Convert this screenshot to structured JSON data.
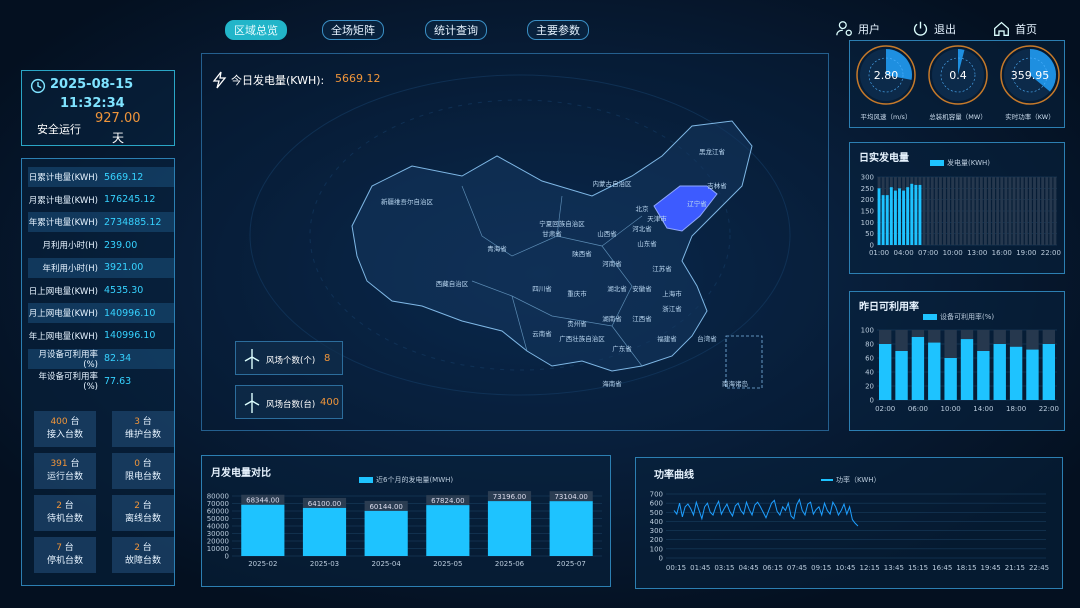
{
  "nav": {
    "tabs": [
      {
        "label": "区域总览",
        "active": true
      },
      {
        "label": "全场矩阵"
      },
      {
        "label": "统计查询"
      },
      {
        "label": "主要参数"
      }
    ],
    "user": "用户",
    "logout": "退出",
    "home": "首页"
  },
  "status": {
    "date": "2025-08-15",
    "time": "11:32:34",
    "safe_label": "安全运行",
    "safe_days": "927.00",
    "days_unit": "天"
  },
  "stats": [
    {
      "label": "日累计电量(KWH)",
      "value": "5669.12"
    },
    {
      "label": "月累计电量(KWH)",
      "value": "176245.12"
    },
    {
      "label": "年累计电量(KWH)",
      "value": "2734885.12"
    },
    {
      "label": "月利用小时(H)",
      "value": "239.00"
    },
    {
      "label": "年利用小时(H)",
      "value": "3921.00"
    },
    {
      "label": "日上网电量(KWH)",
      "value": "4535.30"
    },
    {
      "label": "月上网电量(KWH)",
      "value": "140996.10"
    },
    {
      "label": "年上网电量(KWH)",
      "value": "140996.10"
    },
    {
      "label": "月设备可利用率(%)",
      "value": "82.34"
    },
    {
      "label": "年设备可利用率(%)",
      "value": "77.63"
    }
  ],
  "devices": [
    {
      "num": "400",
      "unit": "台",
      "label": "接入台数"
    },
    {
      "num": "3",
      "unit": "台",
      "label": "维护台数"
    },
    {
      "num": "391",
      "unit": "台",
      "label": "运行台数"
    },
    {
      "num": "0",
      "unit": "台",
      "label": "限电台数"
    },
    {
      "num": "2",
      "unit": "台",
      "label": "待机台数"
    },
    {
      "num": "2",
      "unit": "台",
      "label": "离线台数"
    },
    {
      "num": "7",
      "unit": "台",
      "label": "停机台数"
    },
    {
      "num": "2",
      "unit": "台",
      "label": "故障台数"
    }
  ],
  "map": {
    "today_label": "今日发电量(KWH):",
    "today_value": "5669.12",
    "farm_count_label": "风场个数(个)",
    "farm_count": "8",
    "turbine_count_label": "风场台数(台)",
    "turbine_count": "400",
    "provinces": [
      "黑龙江省",
      "吉林省",
      "辽宁省",
      "内蒙古自治区",
      "新疆维吾尔自治区",
      "甘肃省",
      "宁夏回族自治区",
      "北京",
      "天津市",
      "河北省",
      "山西省",
      "山东省",
      "青海省",
      "陕西省",
      "河南省",
      "江苏省",
      "西藏自治区",
      "四川省",
      "重庆市",
      "湖北省",
      "安徽省",
      "上海市",
      "浙江省",
      "湖南省",
      "江西省",
      "贵州省",
      "云南省",
      "广西壮族自治区",
      "广东省",
      "福建省",
      "台湾省",
      "海南省",
      "南海诸岛"
    ]
  },
  "gauges": [
    {
      "value": "2.80",
      "label": "平均风速（m/s）",
      "fraction": 0.28
    },
    {
      "value": "0.4",
      "label": "总装机容量（MW）",
      "fraction": 0.04
    },
    {
      "value": "359.95",
      "label": "实时功率（KW）",
      "fraction": 0.36
    }
  ],
  "colors": {
    "accent": "#1ec3ff",
    "highlight": "#3d5bff",
    "number": "#f0953a",
    "frame": "#2c7fb2"
  },
  "charts": {
    "daily": {
      "title": "日实发电量",
      "legend": "发电量(KWH)"
    },
    "avail": {
      "title": "昨日可利用率",
      "legend": "设备可利用率(%)"
    },
    "monthly": {
      "title": "月发电量对比",
      "legend": "近6个月的发电量(MWH)"
    },
    "power": {
      "title": "功率曲线",
      "legend": "功率（KWH）"
    }
  },
  "chart_data": [
    {
      "type": "bar",
      "title": "日实发电量",
      "legend": "发电量(KWH)",
      "x": [
        "01:00",
        "01:30",
        "02:00",
        "02:30",
        "03:00",
        "03:30",
        "04:00",
        "04:30",
        "05:00",
        "05:30",
        "06:00",
        "06:30",
        "07:00",
        "07:30",
        "08:00",
        "08:30",
        "09:00",
        "09:30",
        "10:00",
        "10:30",
        "11:00",
        "11:30",
        "12:00",
        "12:30",
        "13:00",
        "13:30",
        "14:00",
        "14:30",
        "15:00",
        "15:30",
        "16:00",
        "16:30",
        "17:00",
        "17:30",
        "18:00",
        "18:30",
        "19:00",
        "19:30",
        "20:00",
        "20:30",
        "21:00",
        "21:30",
        "22:00",
        "22:30"
      ],
      "values": [
        250,
        220,
        220,
        255,
        240,
        250,
        240,
        255,
        270,
        265,
        265
      ],
      "ylim": [
        0,
        300
      ],
      "yticks": [
        0,
        50,
        100,
        150,
        200,
        250,
        300
      ],
      "xticks": [
        "01:00",
        "04:00",
        "07:00",
        "10:00",
        "13:00",
        "16:00",
        "19:00",
        "22:00"
      ]
    },
    {
      "type": "bar",
      "title": "昨日可利用率",
      "legend": "设备可利用率(%)",
      "categories": [
        "02:00",
        "04:00",
        "06:00",
        "08:00",
        "10:00",
        "12:00",
        "14:00",
        "16:00",
        "18:00",
        "20:00",
        "22:00"
      ],
      "values": [
        80,
        70,
        90,
        82,
        60,
        87,
        70,
        80,
        76,
        72,
        80
      ],
      "ylim": [
        0,
        100
      ],
      "yticks": [
        0,
        20,
        40,
        60,
        80,
        100
      ],
      "xticks": [
        "02:00",
        "06:00",
        "10:00",
        "14:00",
        "18:00",
        "22:00"
      ]
    },
    {
      "type": "bar",
      "title": "月发电量对比",
      "legend": "近6个月的发电量(MWH)",
      "categories": [
        "2025-02",
        "2025-03",
        "2025-04",
        "2025-05",
        "2025-06",
        "2025-07"
      ],
      "values": [
        68344,
        64100,
        60144,
        67824,
        73196,
        73104
      ],
      "labels": [
        "68344.00",
        "64100.00",
        "60144.00",
        "67824.00",
        "73196.00",
        "73104.00"
      ],
      "ylim": [
        0,
        80000
      ],
      "yticks": [
        0,
        10000,
        20000,
        30000,
        40000,
        50000,
        60000,
        70000,
        80000
      ]
    },
    {
      "type": "line",
      "title": "功率曲线",
      "legend": "功率（KWH）",
      "ylim": [
        0,
        700
      ],
      "yticks": [
        0,
        100,
        200,
        300,
        400,
        500,
        600,
        700
      ],
      "xticks": [
        "00:15",
        "01:45",
        "03:15",
        "04:45",
        "06:15",
        "07:45",
        "09:15",
        "10:45",
        "12:15",
        "13:45",
        "15:15",
        "16:45",
        "18:15",
        "19:45",
        "21:15",
        "22:45"
      ],
      "values": [
        520,
        480,
        600,
        450,
        560,
        590,
        540,
        470,
        610,
        520,
        430,
        560,
        600,
        500,
        470,
        560,
        620,
        480,
        540,
        590,
        510,
        460,
        570,
        600,
        520,
        480,
        610,
        530,
        470,
        580,
        610,
        560,
        500,
        440,
        520,
        600,
        630,
        510,
        470,
        560,
        520,
        600,
        460,
        430,
        580,
        640,
        520,
        470,
        590,
        610,
        480,
        530,
        560,
        470,
        600,
        520,
        480,
        610,
        560,
        470,
        520,
        590,
        480,
        560,
        420,
        380,
        350
      ]
    }
  ]
}
